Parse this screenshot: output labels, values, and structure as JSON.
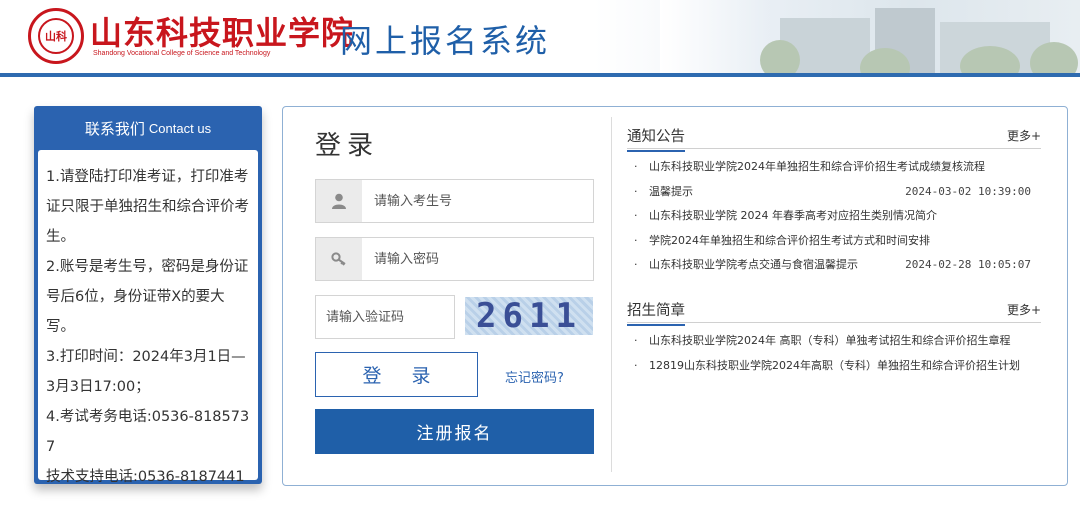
{
  "header": {
    "school_name": "山东科技职业学院",
    "school_name_en": "Shandong Vocational College of Science and Technology",
    "system_title": "网上报名系统"
  },
  "contact": {
    "title_cn": "联系我们",
    "title_en": "Contact us",
    "lines": [
      "1.请登陆打印准考证，打印准考证只限于单独招生和综合评价考生。",
      "2.账号是考生号，密码是身份证号后6位，身份证带X的要大写。",
      "3.打印时间：2024年3月1日—3月3日17:00；",
      "4.考试考务电话:0536-8185737",
      "技术支持电话:0536-8187441"
    ]
  },
  "login": {
    "title": "登录",
    "username_placeholder": "请输入考生号",
    "password_placeholder": "请输入密码",
    "captcha_placeholder": "请输入验证码",
    "captcha_code": "2611",
    "login_button": "登 录",
    "forgot_link": "忘记密码?",
    "register_button": "注册报名",
    "icons": [
      "user-icon",
      "key-icon"
    ]
  },
  "notices": {
    "title": "通知公告",
    "more": "更多+",
    "items": [
      {
        "text": "山东科技职业学院2024年单独招生和综合评价招生考试成绩复核流程",
        "date": ""
      },
      {
        "text": "温馨提示",
        "date": "2024-03-02 10:39:00"
      },
      {
        "text": "山东科技职业学院 2024 年春季高考对应招生类别情况简介",
        "date": ""
      },
      {
        "text": "学院2024年单独招生和综合评价招生考试方式和时间安排",
        "date": ""
      },
      {
        "text": "山东科技职业学院考点交通与食宿温馨提示",
        "date": "2024-02-28 10:05:07"
      }
    ]
  },
  "brochure": {
    "title": "招生简章",
    "more": "更多+",
    "items": [
      {
        "text": "山东科技职业学院2024年 高职（专科）单独考试招生和综合评价招生章程",
        "date": ""
      },
      {
        "text": "12819山东科技职业学院2024年高职（专科）单独招生和综合评价招生计划",
        "date": ""
      }
    ]
  },
  "colors": {
    "brand_red": "#c8161d",
    "brand_blue": "#1f5fa8",
    "panel_blue": "#2b63b0"
  }
}
